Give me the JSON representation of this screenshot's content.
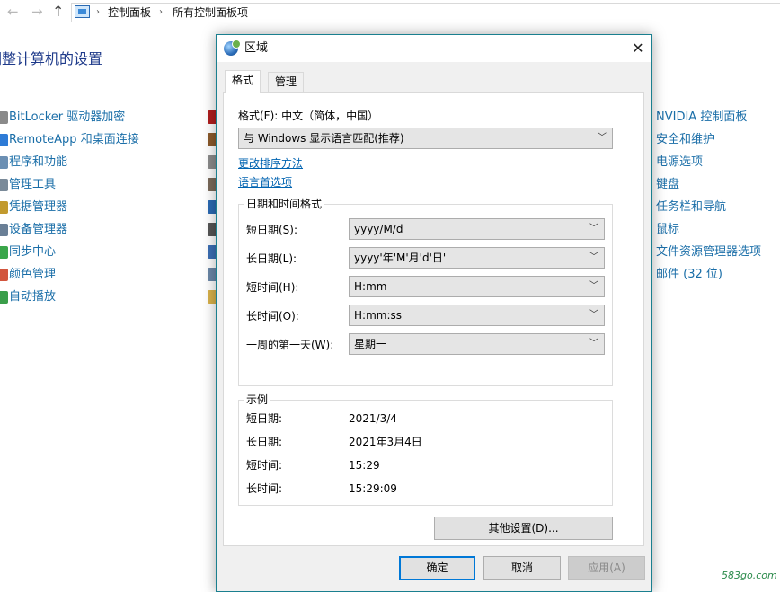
{
  "explorer": {
    "back_icon": "arrow-left-icon",
    "forward_icon": "arrow-right-icon",
    "up_icon": "arrow-up-icon",
    "breadcrumb": [
      "控制面板",
      "所有控制面板项"
    ]
  },
  "control_panel": {
    "title": "调整计算机的设置",
    "left_items": [
      {
        "label": "BitLocker 驱动器加密",
        "color": "#8a8a8a"
      },
      {
        "label": "RemoteApp 和桌面连接",
        "color": "#2e7bd6"
      },
      {
        "label": "程序和功能",
        "color": "#6b8fb3"
      },
      {
        "label": "管理工具",
        "color": "#7a8a99"
      },
      {
        "label": "凭据管理器",
        "color": "#c29a2e"
      },
      {
        "label": "设备管理器",
        "color": "#6a7f96"
      },
      {
        "label": "同步中心",
        "color": "#3aa64a"
      },
      {
        "label": "颜色管理",
        "color": "#d2553d"
      },
      {
        "label": "自动播放",
        "color": "#3a9e4a"
      }
    ],
    "mid_icon_colors": [
      "#b01e1e",
      "#8b5a2b",
      "#8c8c8c",
      "#7a6a5a",
      "#2a6ab3",
      "#555555",
      "#3b6fb5",
      "#6b87a8",
      "#d9b24a"
    ],
    "right_items": [
      "NVIDIA 控制面板",
      "安全和维护",
      "电源选项",
      "键盘",
      "任务栏和导航",
      "鼠标",
      "文件资源管理器选项",
      "邮件 (32 位)"
    ]
  },
  "dialog": {
    "title": "区域",
    "tabs": [
      {
        "label": "格式"
      },
      {
        "label": "管理"
      }
    ],
    "format_label": "格式(F): 中文（简体，中国）",
    "format_value": "与 Windows 显示语言匹配(推荐)",
    "link_sort": "更改排序方法",
    "link_lang": "语言首选项",
    "datetime_group": "日期和时间格式",
    "fields": [
      {
        "label": "短日期(S):",
        "value": "yyyy/M/d"
      },
      {
        "label": "长日期(L):",
        "value": "yyyy'年'M'月'd'日'"
      },
      {
        "label": "短时间(H):",
        "value": "H:mm"
      },
      {
        "label": "长时间(O):",
        "value": "H:mm:ss"
      },
      {
        "label": "一周的第一天(W):",
        "value": "星期一"
      }
    ],
    "example_group": "示例",
    "examples": [
      {
        "label": "短日期:",
        "value": "2021/3/4"
      },
      {
        "label": "长日期:",
        "value": "2021年3月4日"
      },
      {
        "label": "短时间:",
        "value": "15:29"
      },
      {
        "label": "长时间:",
        "value": "15:29:09"
      }
    ],
    "other_settings": "其他设置(D)...",
    "ok": "确定",
    "cancel": "取消",
    "apply": "应用(A)"
  },
  "watermark": "583go.com",
  "colors": {
    "accent": "#0078d7",
    "dialog_border": "#1a7f8f",
    "link": "#0063b1",
    "cp_link": "#1a6ea8"
  }
}
